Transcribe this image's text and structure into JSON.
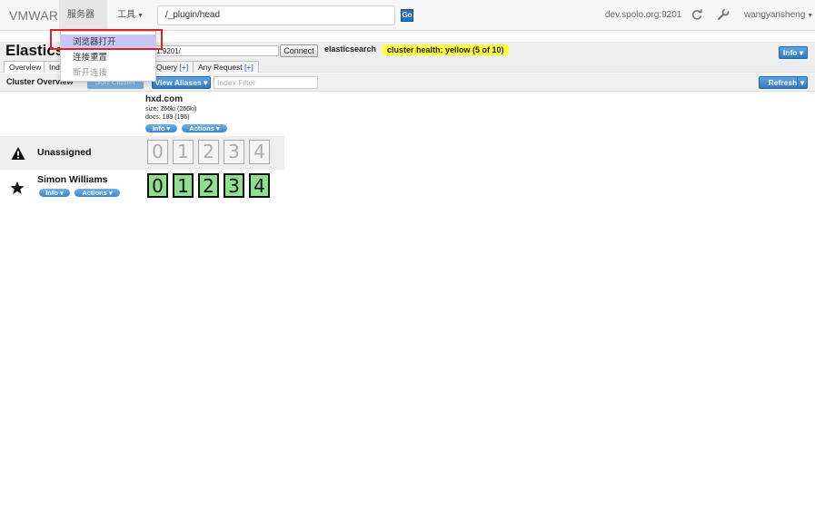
{
  "topnav": {
    "brand": "VMWARE",
    "menu_server": "服务器",
    "menu_tools": "工具",
    "url": "/_plugin/head",
    "go_label": "Go",
    "host": "dev.spolo.org:9201",
    "user": "wangyansheng"
  },
  "server_menu": {
    "items": [
      {
        "label": "浏览器打开",
        "state": "highlighted"
      },
      {
        "label": "连接重置",
        "state": "normal"
      },
      {
        "label": "断开连接",
        "state": "disabled"
      }
    ]
  },
  "header": {
    "title": "Elastics",
    "connect_url": ":1:9201/",
    "connect_label": "Connect",
    "cluster_name": "elasticsearch",
    "health": "cluster health: yellow (5 of 10)",
    "health_color": "#ffff3a",
    "info_label": "Info"
  },
  "tabs": [
    {
      "label": "Overview",
      "active": true
    },
    {
      "label": "Ind",
      "active": false
    },
    {
      "label": "Query",
      "plus": "[+]",
      "active": false
    },
    {
      "label": "Any Request",
      "plus": "[+]",
      "active": false
    }
  ],
  "toolbar": {
    "cluster_overview": "Cluster Overview",
    "sort_cluster": "Sort Cluster",
    "view_aliases": "View Aliases",
    "index_filter_placeholder": "Index Filter",
    "refresh": "Refresh"
  },
  "index": {
    "name": "hxd.com",
    "size": "size: 266ki (266ki)",
    "docs": "docs: 189 (196)",
    "info": "Info",
    "actions": "Actions"
  },
  "nodes": [
    {
      "name": "Unassigned",
      "icon": "warning-icon",
      "shards": [
        "0",
        "1",
        "2",
        "3",
        "4"
      ],
      "shard_state": "unassigned"
    },
    {
      "name": "Simon Williams",
      "icon": "star-icon",
      "shards": [
        "0",
        "1",
        "2",
        "3",
        "4"
      ],
      "shard_state": "primary",
      "info": "Info",
      "actions": "Actions"
    }
  ],
  "colors": {
    "accent_blue": "#3b86cf",
    "shard_green": "#8ee08e",
    "highlight_red": "#e0202a"
  }
}
